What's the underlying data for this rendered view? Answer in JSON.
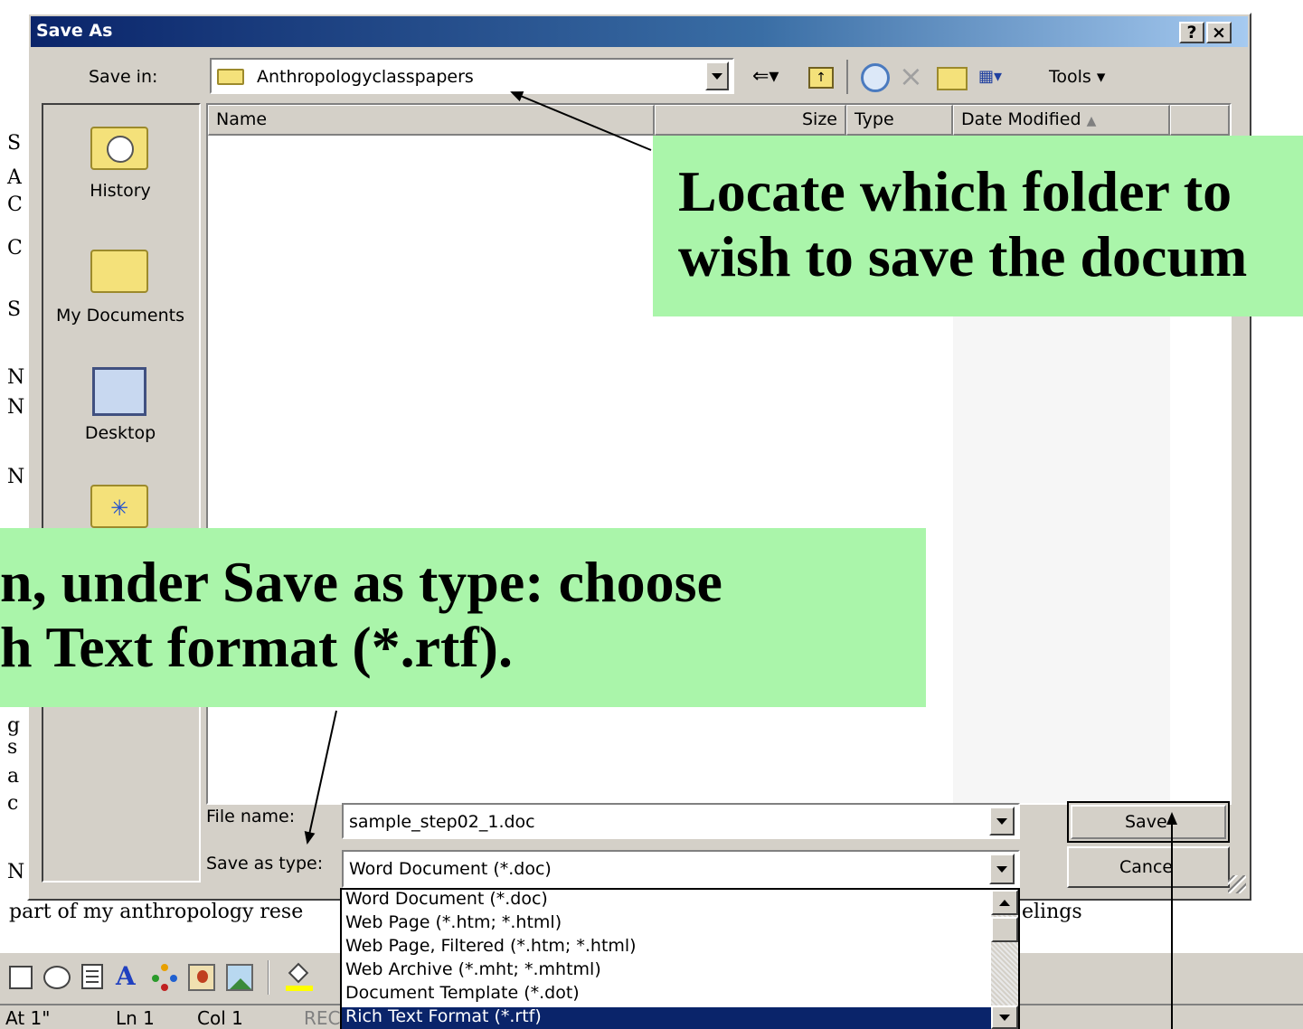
{
  "dialog": {
    "title": "Save As",
    "help_btn": "?",
    "close_btn": "×",
    "save_in_label": "Save in:",
    "save_in_value": "Anthropologyclasspapers",
    "tools_label": "Tools",
    "columns": [
      "Name",
      "Size",
      "Type",
      "Date Modified"
    ],
    "places": [
      "History",
      "My Documents",
      "Desktop"
    ],
    "file_name_label": "File name:",
    "file_name_value": "sample_step02_1.doc",
    "save_type_label": "Save as type:",
    "save_type_value": "Word Document (*.doc)",
    "save_button": "Save",
    "cancel_button": "Cance",
    "type_options": [
      "Word Document (*.doc)",
      "Web Page (*.htm; *.html)",
      "Web Page, Filtered (*.htm; *.html)",
      "Web Archive (*.mht; *.mhtml)",
      "Document Template (*.dot)",
      "Rich Text Format (*.rtf)"
    ],
    "selected_option_index": 5
  },
  "callouts": {
    "folder_line1": "Locate which folder to",
    "folder_line2": "wish to save the docum",
    "type_line1": "n, under Save as type: choose",
    "type_line2": "h Text format (*.rtf)."
  },
  "document": {
    "left_letters": [
      "S",
      "A",
      "C",
      "C",
      "S",
      "N",
      "N",
      "N",
      "g",
      "s",
      "a",
      "c",
      "N"
    ],
    "body_line_left": "part of my anthropology rese",
    "body_line_right": "elings"
  },
  "statusbar": {
    "at": "At 1\"",
    "ln": "Ln 1",
    "col": "Col 1",
    "rec": "REC"
  },
  "colors": {
    "callout_bg": "#aaf5aa",
    "title_gradient_start": "#0a246a",
    "selection": "#0a246a",
    "chrome": "#d4d0c8"
  }
}
